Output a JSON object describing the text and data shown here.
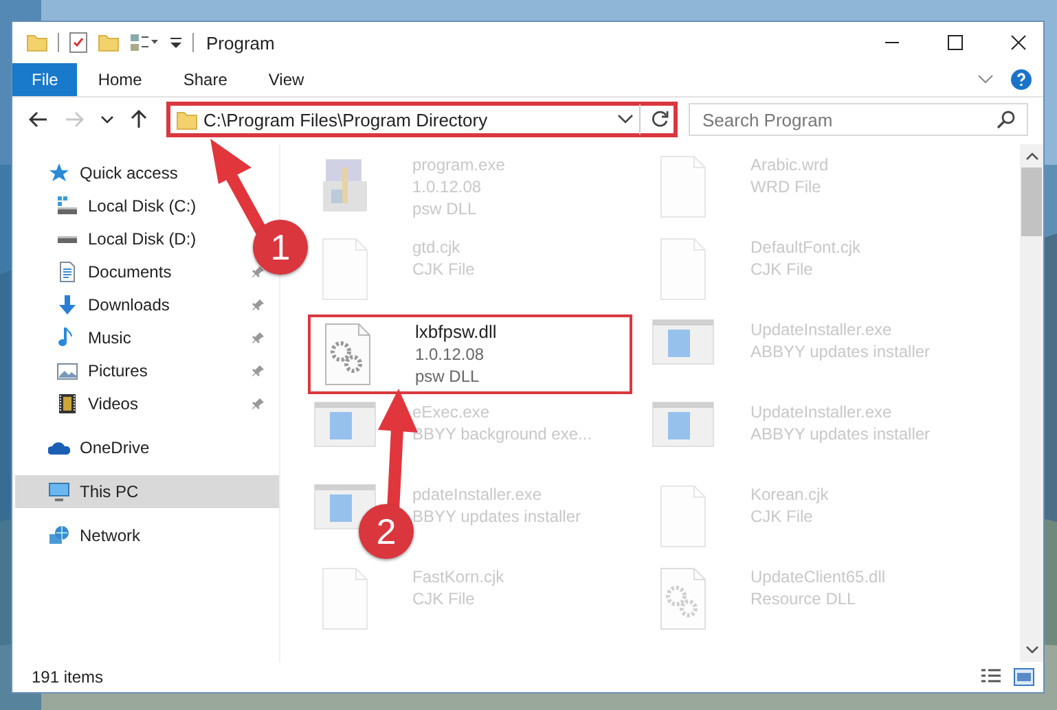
{
  "window": {
    "title": "Program"
  },
  "ribbon": {
    "tabs": [
      {
        "label": "File",
        "kind": "file"
      },
      {
        "label": "Home",
        "kind": "tab"
      },
      {
        "label": "Share",
        "kind": "tab"
      },
      {
        "label": "View",
        "kind": "tab"
      }
    ]
  },
  "navigation": [
    {
      "kind": "back",
      "disabled": false
    },
    {
      "kind": "forward",
      "disabled": true
    },
    {
      "kind": "recent",
      "disabled": false
    },
    {
      "kind": "up",
      "disabled": false
    }
  ],
  "address": {
    "path": "C:\\Program Files\\Program Directory",
    "highlighted": true
  },
  "search": {
    "placeholder": "Search Program"
  },
  "sidebar": {
    "items": [
      {
        "label": "Quick access",
        "kind": "star",
        "selected": false,
        "children": [
          {
            "label": "Local Disk (C:)",
            "kind": "drive-c"
          },
          {
            "label": "Local Disk (D:)",
            "kind": "drive"
          },
          {
            "label": "Documents",
            "kind": "documents",
            "pinned": true
          },
          {
            "label": "Downloads",
            "kind": "downloads",
            "pinned": true
          },
          {
            "label": "Music",
            "kind": "music",
            "pinned": true
          },
          {
            "label": "Pictures",
            "kind": "pictures",
            "pinned": true
          },
          {
            "label": "Videos",
            "kind": "videos",
            "pinned": true
          }
        ]
      },
      {
        "label": "OneDrive",
        "kind": "cloud",
        "selected": false
      },
      {
        "label": "This PC",
        "kind": "pc",
        "selected": true
      },
      {
        "label": "Network",
        "kind": "network",
        "selected": false
      }
    ]
  },
  "files": [
    {
      "name": "program.exe",
      "lines": [
        "1.0.12.08",
        "psw DLL"
      ],
      "kind": "installer",
      "highlighted": false
    },
    {
      "name": "Arabic.wrd",
      "lines": [
        "WRD File"
      ],
      "kind": "blank",
      "highlighted": false
    },
    {
      "name": "gtd.cjk",
      "lines": [
        "CJK File"
      ],
      "kind": "blank",
      "highlighted": false
    },
    {
      "name": "DefaultFont.cjk",
      "lines": [
        "CJK File"
      ],
      "kind": "blank",
      "highlighted": false
    },
    {
      "name": "lxbfpsw.dll",
      "lines": [
        "1.0.12.08",
        "psw DLL"
      ],
      "kind": "settings",
      "highlighted": true
    },
    {
      "name": "UpdateInstaller.exe",
      "lines": [
        "ABBYY updates installer"
      ],
      "kind": "app",
      "highlighted": false
    },
    {
      "name": "eExec.exe",
      "lines": [
        "BBYY background exe..."
      ],
      "kind": "app",
      "highlighted": false
    },
    {
      "name": "UpdateInstaller.exe",
      "lines": [
        "ABBYY updates installer"
      ],
      "kind": "app",
      "highlighted": false
    },
    {
      "name": "pdateInstaller.exe",
      "lines": [
        "BBYY updates installer"
      ],
      "kind": "app",
      "highlighted": false
    },
    {
      "name": "Korean.cjk",
      "lines": [
        "CJK File"
      ],
      "kind": "blank",
      "highlighted": false
    },
    {
      "name": "FastKorn.cjk",
      "lines": [
        "CJK File"
      ],
      "kind": "blank",
      "highlighted": false
    },
    {
      "name": "UpdateClient65.dll",
      "lines": [
        "Resource DLL"
      ],
      "kind": "settings",
      "highlighted": false
    }
  ],
  "status_bar": {
    "count": "191 items"
  },
  "callouts": [
    {
      "number": "1"
    },
    {
      "number": "2"
    }
  ]
}
